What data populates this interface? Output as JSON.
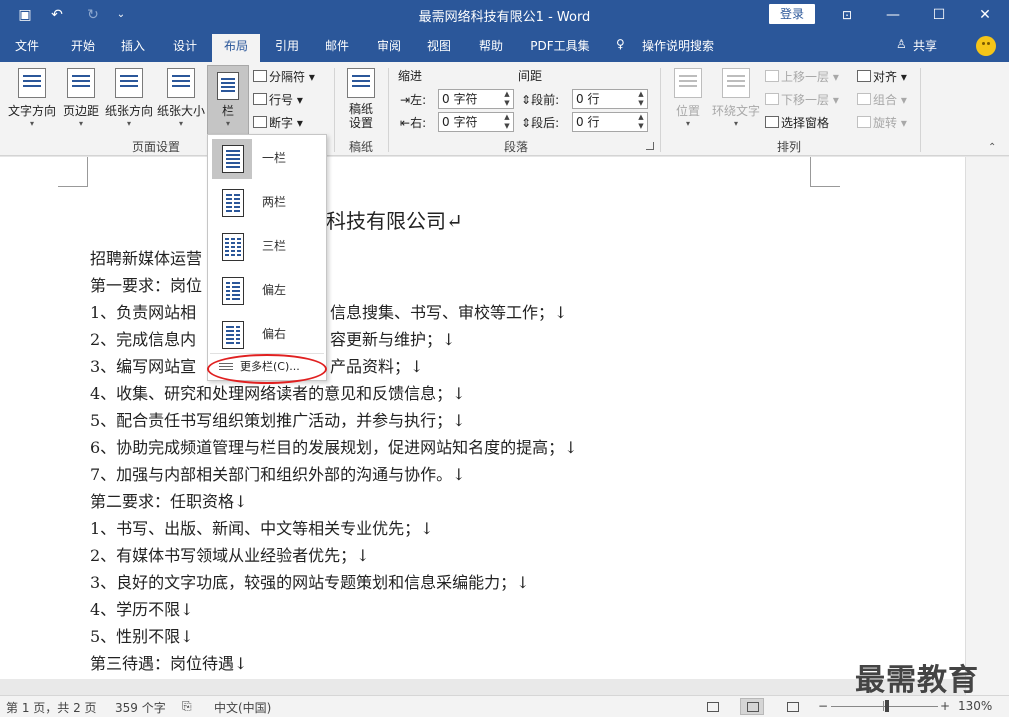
{
  "app": {
    "title": "最需网络科技有限公1 - Word",
    "login": "登录"
  },
  "tabs": [
    "文件",
    "开始",
    "插入",
    "设计",
    "布局",
    "引用",
    "邮件",
    "审阅",
    "视图",
    "帮助",
    "PDF工具集"
  ],
  "tell_me": "操作说明搜索",
  "share": "共享",
  "ribbon": {
    "page_setup": {
      "text_direction": "文字方向",
      "margins": "页边距",
      "orientation": "纸张方向",
      "size": "纸张大小",
      "columns": "栏",
      "breaks": "分隔符",
      "line_numbers": "行号",
      "hyphenation": "断字",
      "group": "页面设置"
    },
    "draft": {
      "label": "稿纸\n设置",
      "label1": "稿纸",
      "label2": "设置",
      "group": "稿纸"
    },
    "paragraph": {
      "indent_title": "缩进",
      "spacing_title": "间距",
      "left_label": "左:",
      "right_label": "右:",
      "before_label": "段前:",
      "after_label": "段后:",
      "left_value": "0 字符",
      "right_value": "0 字符",
      "before_value": "0 行",
      "after_value": "0 行",
      "group": "段落"
    },
    "arrange": {
      "position": "位置",
      "wrap": "环绕文字",
      "bring_forward": "上移一层",
      "send_backward": "下移一层",
      "selection_pane": "选择窗格",
      "align": "对齐",
      "group_btn": "组合",
      "rotate": "旋转",
      "group": "排列"
    }
  },
  "columns_menu": {
    "items": [
      "一栏",
      "两栏",
      "三栏",
      "偏左",
      "偏右"
    ],
    "more": "更多栏(C)..."
  },
  "document": {
    "title_partial": "科技有限公司↵",
    "lines": [
      "招聘新媒体运营",
      "第一要求：岗位",
      "1、负责网站相",
      "2、完成信息内",
      "3、编写网站宣",
      "4、收集、研究和处理网络读者的意见和反馈信息；↓",
      "5、配合责任书写组织策划推广活动，并参与执行；↓",
      "6、协助完成频道管理与栏目的发展规划，促进网站知名度的提高；↓",
      "7、加强与内部相关部门和组织外部的沟通与协作。↓",
      "第二要求：任职资格↓",
      "1、书写、出版、新闻、中文等相关专业优先；↓",
      "2、有媒体书写领域从业经验者优先；↓",
      "3、良好的文字功底，较强的网站专题策划和信息采编能力；↓",
      "4、学历不限↓",
      "5、性别不限↓",
      "第三待遇：岗位待遇↓"
    ],
    "fragments": [
      "信息搜集、书写、审校等工作；↓",
      "容更新与维护；↓",
      "产品资料；↓"
    ]
  },
  "status": {
    "page": "第 1 页，共 2 页",
    "words": "359 个字",
    "lang": "中文(中国)",
    "zoom": "130%",
    "zoom_minus": "−",
    "zoom_plus": "+"
  },
  "watermark": "最需教育",
  "colors": {
    "accent": "#2b579a",
    "highlight": "#e02020"
  }
}
